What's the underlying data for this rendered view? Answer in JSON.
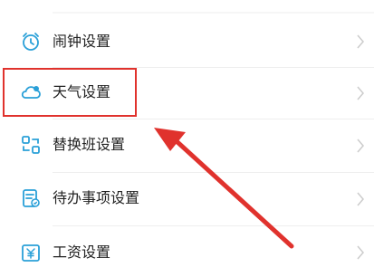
{
  "settings": {
    "items": [
      {
        "label": "闹钟设置",
        "icon": "alarm-clock-icon"
      },
      {
        "label": "天气设置",
        "icon": "weather-cloud-icon"
      },
      {
        "label": "替换班设置",
        "icon": "shift-swap-icon"
      },
      {
        "label": "待办事项设置",
        "icon": "todo-list-icon"
      },
      {
        "label": "工资设置",
        "icon": "salary-yuan-icon"
      }
    ],
    "chevron_icon": "chevron-right-icon"
  },
  "annotation": {
    "highlight_color": "#e0322d",
    "accent_color": "#2aa0d8"
  }
}
